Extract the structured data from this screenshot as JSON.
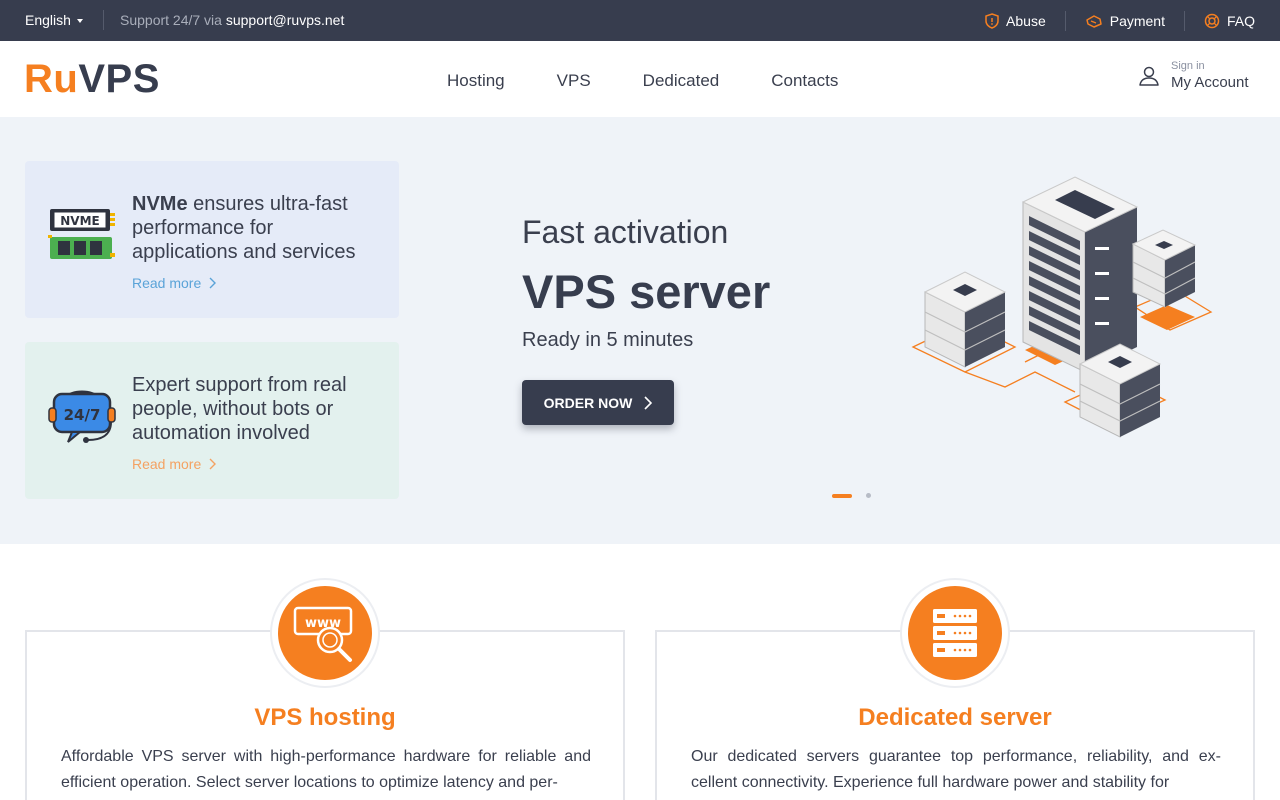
{
  "topbar": {
    "language": "English",
    "support_prefix": "Support 24/7 via",
    "support_email": "support@ruvps.net",
    "links": {
      "abuse": "Abuse",
      "payment": "Payment",
      "faq": "FAQ"
    }
  },
  "header": {
    "logo_ru": "Ru",
    "logo_vps": "VPS",
    "nav": {
      "hosting": "Hosting",
      "vps": "VPS",
      "dedicated": "Dedicated",
      "contacts": "Contacts"
    },
    "account": {
      "sign_in": "Sign in",
      "my_account": "My Account"
    }
  },
  "hero": {
    "cards": [
      {
        "bold": "NVMe",
        "text": " ensures ultra-fast performance for applications and services",
        "read_more": "Read more",
        "icon": "nvme-icon",
        "icon_label": "NVME"
      },
      {
        "text": "Expert support from real people, without bots or automation involved",
        "read_more": "Read more",
        "icon": "support-24-7-icon",
        "icon_label": "24/7"
      }
    ],
    "slide": {
      "subtitle": "Fast activation",
      "title": "VPS server",
      "tagline": "Ready in 5 minutes",
      "button": "ORDER NOW"
    },
    "slider": {
      "total": 2,
      "active": 1
    }
  },
  "services": [
    {
      "title": "VPS hosting",
      "text": "Affordable VPS server with high-performance hardware for reliable and efficient operation. Select server locations to optimize latency and per-",
      "icon": "www-search-icon"
    },
    {
      "title": "Dedicated server",
      "text": "Our dedicated servers guarantee top performance, reliability, and ex- cellent connectivity. Experience full hardware power and stability for",
      "icon": "server-rack-icon"
    }
  ],
  "colors": {
    "accent": "#f57f20",
    "dark": "#373d4e",
    "hero_bg": "#eff3f8",
    "card_blue": "#e5ebf8",
    "card_green": "#e3f1ee",
    "link_blue": "#5aa3d8",
    "link_orange": "#f4a262"
  }
}
